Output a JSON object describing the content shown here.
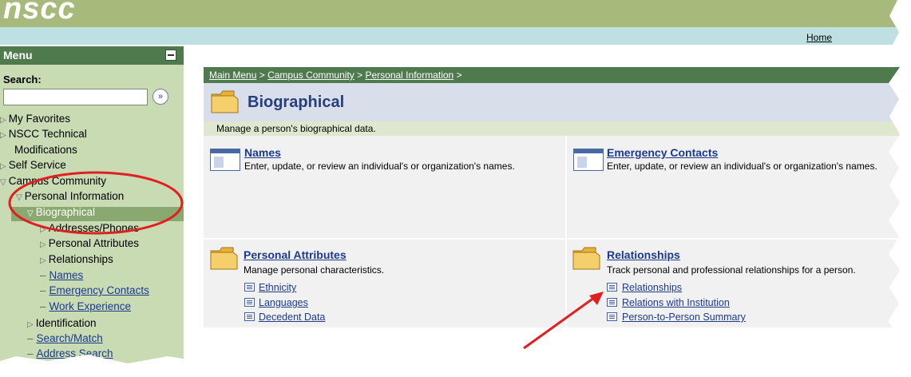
{
  "header": {
    "logo_text": "nscc",
    "home_link": "Home"
  },
  "menu": {
    "title": "Menu",
    "search_label": "Search:",
    "search_value": "",
    "search_go_icon": "double-chevron-right-icon",
    "items": {
      "my_favorites": "My Favorites",
      "nscc_tech_1": "NSCC Technical",
      "nscc_tech_2": "Modifications",
      "self_service": "Self Service",
      "campus_community": "Campus Community",
      "personal_information": "Personal Information",
      "biographical": "Biographical",
      "addresses_phones": "Addresses/Phones",
      "personal_attributes": "Personal Attributes",
      "relationships": "Relationships",
      "names": "Names",
      "emergency_contacts": "Emergency Contacts",
      "work_experience": "Work Experience",
      "identification": "Identification",
      "search_match": "Search/Match",
      "address_search": "Address Search"
    }
  },
  "main": {
    "breadcrumb": {
      "main_menu": "Main Menu",
      "campus_community": "Campus Community",
      "personal_information": "Personal Information",
      "sep": ">"
    },
    "title": "Biographical",
    "description": "Manage a person's biographical data.",
    "tiles": {
      "names": {
        "title": "Names",
        "desc": "Enter, update, or review an individual's or organization's names."
      },
      "emergency_contacts": {
        "title": "Emergency Contacts",
        "desc": "Enter, update, or review an individual's or organization's names."
      },
      "personal_attributes": {
        "title": "Personal Attributes",
        "desc": "Manage personal characteristics.",
        "links": [
          "Ethnicity",
          "Languages",
          "Decedent Data"
        ]
      },
      "relationships": {
        "title": "Relationships",
        "desc": "Track personal and professional relationships for a person.",
        "links": [
          "Relationships",
          "Relations with Institution",
          "Person-to-Person Summary"
        ]
      }
    }
  },
  "colors": {
    "banner": "#a7b97b",
    "menu_header": "#4e7a4e",
    "menu_bg": "#c9dbb3",
    "link": "#1b3a8f",
    "annotation": "#e02020"
  }
}
